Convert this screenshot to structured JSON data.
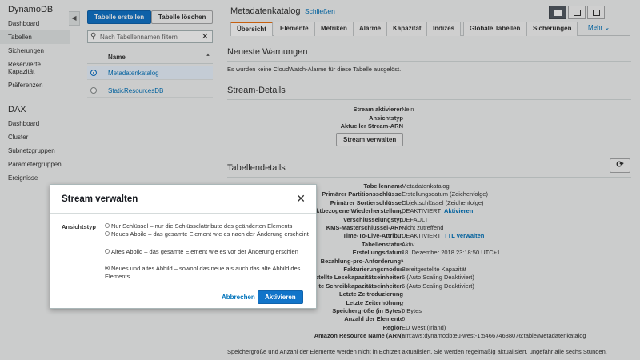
{
  "leftnav": {
    "dynamodb_heading": "DynamoDB",
    "dynamodb_items": [
      "Dashboard",
      "Tabellen",
      "Sicherungen",
      "Reservierte Kapazität",
      "Präferenzen"
    ],
    "dax_heading": "DAX",
    "dax_items": [
      "Dashboard",
      "Cluster",
      "Subnetzgruppen",
      "Parametergruppen",
      "Ereignisse"
    ],
    "active_item": "Tabellen"
  },
  "tablelist": {
    "create_label": "Tabelle erstellen",
    "delete_label": "Tabelle löschen",
    "filter_placeholder": "Nach Tabellennamen filtern",
    "column_name": "Name",
    "rows": [
      {
        "name": "Metadatenkatalog",
        "selected": true
      },
      {
        "name": "StaticResourcesDB",
        "selected": false
      }
    ]
  },
  "detail": {
    "title": "Metadatenkatalog",
    "close_label": "Schließen",
    "tabs": [
      "Übersicht",
      "Elemente",
      "Metriken",
      "Alarme",
      "Kapazität",
      "Indizes",
      "Globale Tabellen",
      "Sicherungen"
    ],
    "more_label": "Mehr",
    "warnings_title": "Neueste Warnungen",
    "warnings_text": "Es wurden keine CloudWatch-Alarme für diese Tabelle ausgelöst.",
    "stream_title": "Stream-Details",
    "stream_rows": [
      {
        "k": "Stream aktivieren",
        "v": "Nein"
      },
      {
        "k": "Ansichtstyp",
        "v": "-"
      },
      {
        "k": "Aktueller Stream-ARN",
        "v": "-"
      }
    ],
    "stream_button": "Stream verwalten",
    "table_title": "Tabellendetails",
    "table_rows": [
      {
        "k": "Tabellenname",
        "v": "Metadatenkatalog",
        "link": ""
      },
      {
        "k": "Primärer Partitionsschlüssel",
        "v": "Erstellungsdatum (Zeichenfolge)",
        "link": ""
      },
      {
        "k": "Primärer Sortierschlüssel",
        "v": "Objektschlüssel (Zeichenfolge)",
        "link": ""
      },
      {
        "k": "Zeitpunktbezogene Wiederherstellung",
        "v": "DEAKTIVIERT",
        "link": "Aktivieren"
      },
      {
        "k": "Verschlüsselungstyp",
        "v": "DEFAULT",
        "link": ""
      },
      {
        "k": "KMS-Masterschlüssel-ARN",
        "v": "Nicht zutreffend",
        "link": ""
      },
      {
        "k": "Time-To-Live-Attribut",
        "v": "DEAKTIVIERT",
        "link": "TTL verwalten"
      },
      {
        "k": "Tabellenstatus",
        "v": "Aktiv",
        "link": ""
      },
      {
        "k": "Erstellungsdatum",
        "v": "18. Dezember 2018 23:18:50 UTC+1",
        "link": ""
      },
      {
        "k": "Bezahlung-pro-Anforderung*",
        "v": "-",
        "link": ""
      },
      {
        "k": "Fakturierungsmodus",
        "v": "Bereitgestellte Kapazität",
        "link": ""
      },
      {
        "k": "Bereitgestellte Lesekapazitätseinheiten",
        "v": "5 (Auto Scaling Deaktiviert)",
        "link": ""
      },
      {
        "k": "Bereitgestellte Schreibkapazitätseinheiten",
        "v": "5 (Auto Scaling Deaktiviert)",
        "link": ""
      },
      {
        "k": "Letzte Zeitreduzierung",
        "v": "-",
        "link": ""
      },
      {
        "k": "Letzte Zeiterhöhung",
        "v": "-",
        "link": ""
      },
      {
        "k": "Speichergröße (in Bytes)",
        "v": "0 Bytes",
        "link": ""
      },
      {
        "k": "Anzahl der Elemente",
        "v": "0",
        "link": ""
      },
      {
        "k": "Region",
        "v": "EU West (Irland)",
        "link": ""
      },
      {
        "k": "Amazon Resource Name (ARN)",
        "v": "arn:aws:dynamodb:eu-west-1:546674688076:table/Metadatenkatalog",
        "link": ""
      }
    ],
    "footer_note": "Speichergröße und Anzahl der Elemente werden nicht in Echtzeit aktualisiert. Sie werden regelmäßig aktualisiert, ungefähr alle sechs Stunden."
  },
  "modal": {
    "title": "Stream verwalten",
    "field_label": "Ansichtstyp",
    "options": [
      {
        "text": "Nur Schlüssel – nur die Schlüsselattribute des geänderten Elements",
        "checked": false
      },
      {
        "text": "Neues Abbild – das gesamte Element wie es nach der Änderung erscheint",
        "checked": false
      },
      {
        "text": "Altes Abbild – das gesamte Element wie es vor der Änderung erschien",
        "checked": false
      },
      {
        "text": "Neues und altes Abbild – sowohl das neue als auch das alte Abbild des Elements",
        "checked": true
      }
    ],
    "cancel_label": "Abbrechen",
    "submit_label": "Aktivieren"
  },
  "colors": {
    "accent": "#1174c9",
    "link": "#0073bb",
    "tab_highlight": "#ec7211"
  }
}
